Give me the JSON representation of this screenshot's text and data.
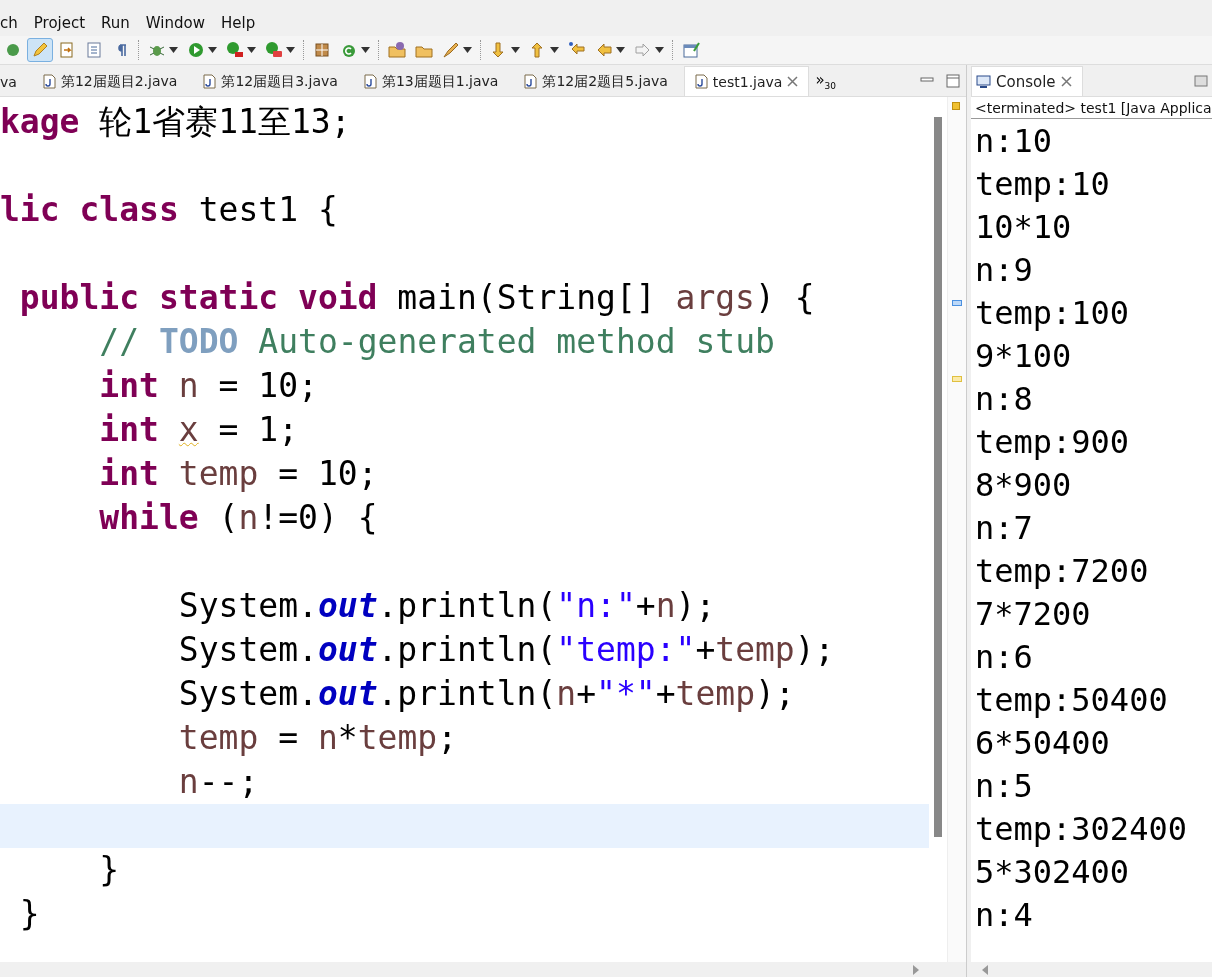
{
  "menu": [
    "ch",
    "Project",
    "Run",
    "Window",
    "Help"
  ],
  "editor_tabs": [
    {
      "label": "va",
      "selected": false,
      "closable": false
    },
    {
      "label": "第12届题目2.java",
      "selected": false,
      "closable": false
    },
    {
      "label": "第12届题目3.java",
      "selected": false,
      "closable": false
    },
    {
      "label": "第13届题目1.java",
      "selected": false,
      "closable": false
    },
    {
      "label": "第12届2题目5.java",
      "selected": false,
      "closable": false
    },
    {
      "label": "test1.java",
      "selected": true,
      "closable": true
    }
  ],
  "overflow": {
    "label": "»",
    "count": "30"
  },
  "editor": {
    "lines": [
      {
        "current": false,
        "tokens": [
          {
            "kind": "keyword",
            "text": "kage"
          },
          {
            "kind": "plain",
            "text": " 轮1省赛11至13;"
          }
        ]
      },
      {
        "kind": "blank"
      },
      {
        "current": false,
        "tokens": [
          {
            "kind": "keyword",
            "text": "lic class"
          },
          {
            "kind": "plain",
            "text": " test1 {"
          }
        ]
      },
      {
        "kind": "blank"
      },
      {
        "current": false,
        "tokens": [
          {
            "kind": "keyword",
            "text": " public static void"
          },
          {
            "kind": "plain",
            "text": " main(String[] "
          },
          {
            "kind": "local",
            "text": "args"
          },
          {
            "kind": "plain",
            "text": ") {"
          }
        ]
      },
      {
        "current": false,
        "tokens": [
          {
            "kind": "comment",
            "text": "     // "
          },
          {
            "kind": "todo",
            "text": "TODO"
          },
          {
            "kind": "comment",
            "text": " Auto-generated method stub"
          }
        ]
      },
      {
        "current": false,
        "tokens": [
          {
            "kind": "keyword",
            "text": "     int"
          },
          {
            "kind": "local",
            "text": " n"
          },
          {
            "kind": "plain",
            "text": " = 10;"
          }
        ]
      },
      {
        "current": false,
        "tokens": [
          {
            "kind": "keyword",
            "text": "     int "
          },
          {
            "kind": "warning",
            "text": "x"
          },
          {
            "kind": "plain",
            "text": " = 1;"
          }
        ]
      },
      {
        "current": false,
        "tokens": [
          {
            "kind": "keyword",
            "text": "     int"
          },
          {
            "kind": "local",
            "text": " temp"
          },
          {
            "kind": "plain",
            "text": " = 10;"
          }
        ]
      },
      {
        "current": false,
        "tokens": [
          {
            "kind": "keyword",
            "text": "     while"
          },
          {
            "kind": "plain",
            "text": " ("
          },
          {
            "kind": "local",
            "text": "n"
          },
          {
            "kind": "plain",
            "text": "!=0) {"
          }
        ]
      },
      {
        "kind": "blank"
      },
      {
        "current": false,
        "tokens": [
          {
            "kind": "plain",
            "text": "         System."
          },
          {
            "kind": "field",
            "text": "out"
          },
          {
            "kind": "plain",
            "text": ".println("
          },
          {
            "kind": "string",
            "text": "\"n:\""
          },
          {
            "kind": "plain",
            "text": "+"
          },
          {
            "kind": "local",
            "text": "n"
          },
          {
            "kind": "plain",
            "text": ");"
          }
        ]
      },
      {
        "current": false,
        "tokens": [
          {
            "kind": "plain",
            "text": "         System."
          },
          {
            "kind": "field",
            "text": "out"
          },
          {
            "kind": "plain",
            "text": ".println("
          },
          {
            "kind": "string",
            "text": "\"temp:\""
          },
          {
            "kind": "plain",
            "text": "+"
          },
          {
            "kind": "local",
            "text": "temp"
          },
          {
            "kind": "plain",
            "text": ");"
          }
        ]
      },
      {
        "current": false,
        "tokens": [
          {
            "kind": "plain",
            "text": "         System."
          },
          {
            "kind": "field",
            "text": "out"
          },
          {
            "kind": "plain",
            "text": ".println("
          },
          {
            "kind": "local",
            "text": "n"
          },
          {
            "kind": "plain",
            "text": "+"
          },
          {
            "kind": "string",
            "text": "\"*\""
          },
          {
            "kind": "plain",
            "text": "+"
          },
          {
            "kind": "local",
            "text": "temp"
          },
          {
            "kind": "plain",
            "text": ");"
          }
        ]
      },
      {
        "current": false,
        "tokens": [
          {
            "kind": "local",
            "text": "         temp"
          },
          {
            "kind": "plain",
            "text": " = "
          },
          {
            "kind": "local",
            "text": "n"
          },
          {
            "kind": "plain",
            "text": "*"
          },
          {
            "kind": "local",
            "text": "temp"
          },
          {
            "kind": "plain",
            "text": ";"
          }
        ]
      },
      {
        "current": false,
        "tokens": [
          {
            "kind": "local",
            "text": "         n"
          },
          {
            "kind": "plain",
            "text": "--;"
          }
        ]
      },
      {
        "kind": "blank",
        "current": true
      },
      {
        "current": false,
        "tokens": [
          {
            "kind": "plain",
            "text": "     }"
          }
        ]
      },
      {
        "current": false,
        "tokens": [
          {
            "kind": "plain",
            "text": " }"
          }
        ]
      }
    ]
  },
  "console": {
    "tab": {
      "label": "Console",
      "selected": true
    },
    "header": "<terminated> test1 [Java Applica",
    "output": [
      "n:10",
      "temp:10",
      "10*10",
      "n:9",
      "temp:100",
      "9*100",
      "n:8",
      "temp:900",
      "8*900",
      "n:7",
      "temp:7200",
      "7*7200",
      "n:6",
      "temp:50400",
      "6*50400",
      "n:5",
      "temp:302400",
      "5*302400",
      "n:4"
    ]
  }
}
